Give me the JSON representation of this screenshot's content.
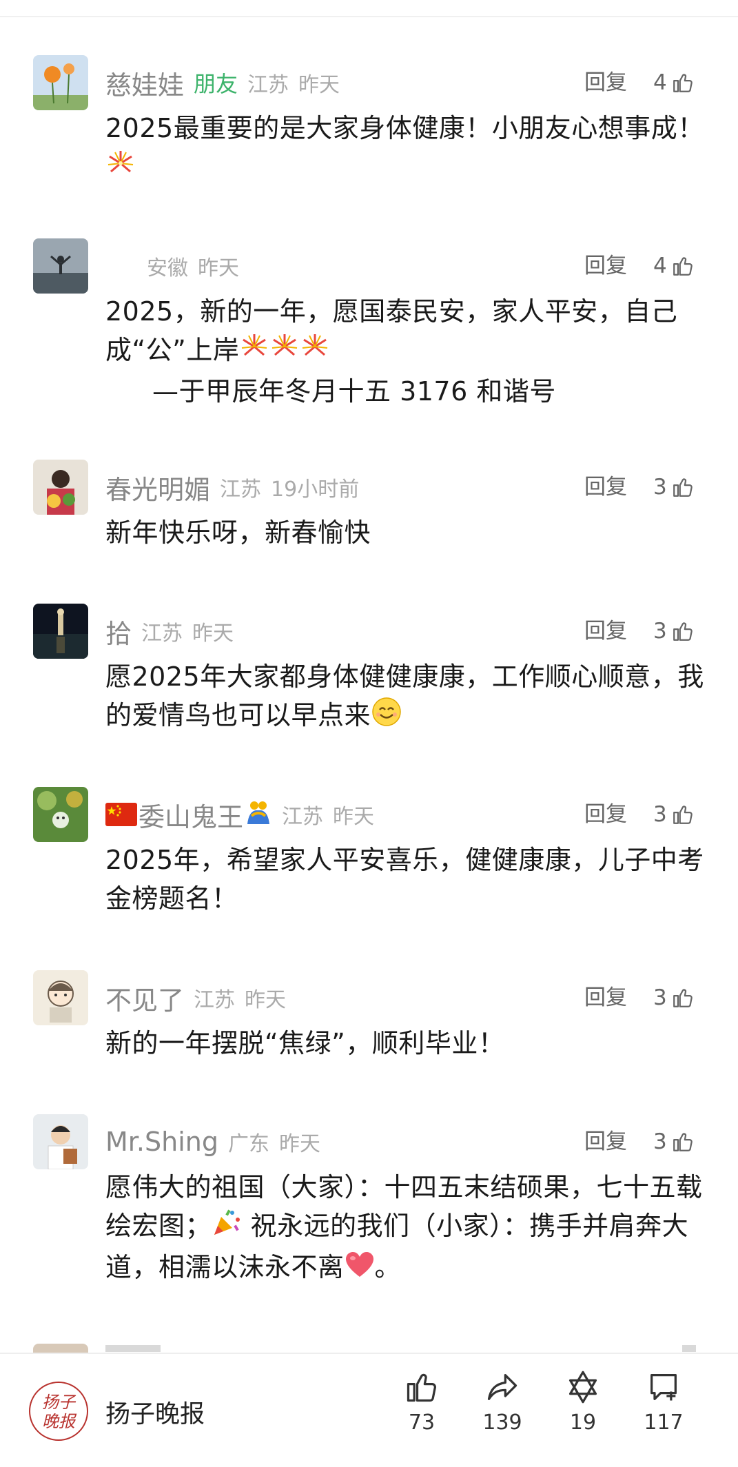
{
  "comments": [
    {
      "name": "慈娃娃",
      "badge": "朋友",
      "location": "江苏",
      "time": "昨天",
      "reply": "回复",
      "likes": "4",
      "text": "2025最重要的是大家身体健康！小朋友心想事成！"
    },
    {
      "name": "",
      "badge": "",
      "location": "安徽",
      "time": "昨天",
      "reply": "回复",
      "likes": "4",
      "text": "2025，新的一年，愿国泰民安，家人平安，自己成“公”上岸",
      "signature": "—于甲辰年冬月十五 3176 和谐号"
    },
    {
      "name": "春光明媚",
      "location": "江苏",
      "time": "19小时前",
      "reply": "回复",
      "likes": "3",
      "text": "新年快乐呀，新春愉快"
    },
    {
      "name": "拾",
      "location": "江苏",
      "time": "昨天",
      "reply": "回复",
      "likes": "3",
      "text": "愿2025年大家都身体健健康康，工作顺心顺意，我的爱情鸟也可以早点来"
    },
    {
      "name": "委山鬼王",
      "location": "江苏",
      "time": "昨天",
      "reply": "回复",
      "likes": "3",
      "text": "2025年，希望家人平安喜乐，健健康康，儿子中考金榜题名！"
    },
    {
      "name": "不见了",
      "location": "江苏",
      "time": "昨天",
      "reply": "回复",
      "likes": "3",
      "text": "新的一年摆脱“焦绿”，顺利毕业！"
    },
    {
      "name": "Mr.Shing",
      "location": "广东",
      "time": "昨天",
      "reply": "回复",
      "likes": "3",
      "text": "愿伟大的祖国（大家）：十四五末结硕果，七十五载绘宏图；",
      "text2": " 祝永远的我们（小家）：携手并肩奔大道，相濡以沫永不离",
      "text3": "。"
    }
  ],
  "bottom_bar": {
    "logo_text": "扬子晚报",
    "brand": "扬子晚报",
    "like_count": "73",
    "share_count": "139",
    "favorite_count": "19",
    "comment_count": "117"
  },
  "icons": {
    "like": "thumbs-up-icon",
    "share": "share-arrow-icon",
    "favorite": "star-of-david-icon",
    "comment": "comment-add-icon",
    "fireworks": "fireworks-emoji",
    "smile": "smiling-face-emoji",
    "party": "party-popper-emoji",
    "heart": "heart-emoji",
    "flag": "china-flag-emoji",
    "hug": "people-hugging-emoji"
  },
  "colors": {
    "friend_badge": "#3db36b",
    "meta": "#aaaaaa",
    "brand_logo": "#b8322e"
  }
}
